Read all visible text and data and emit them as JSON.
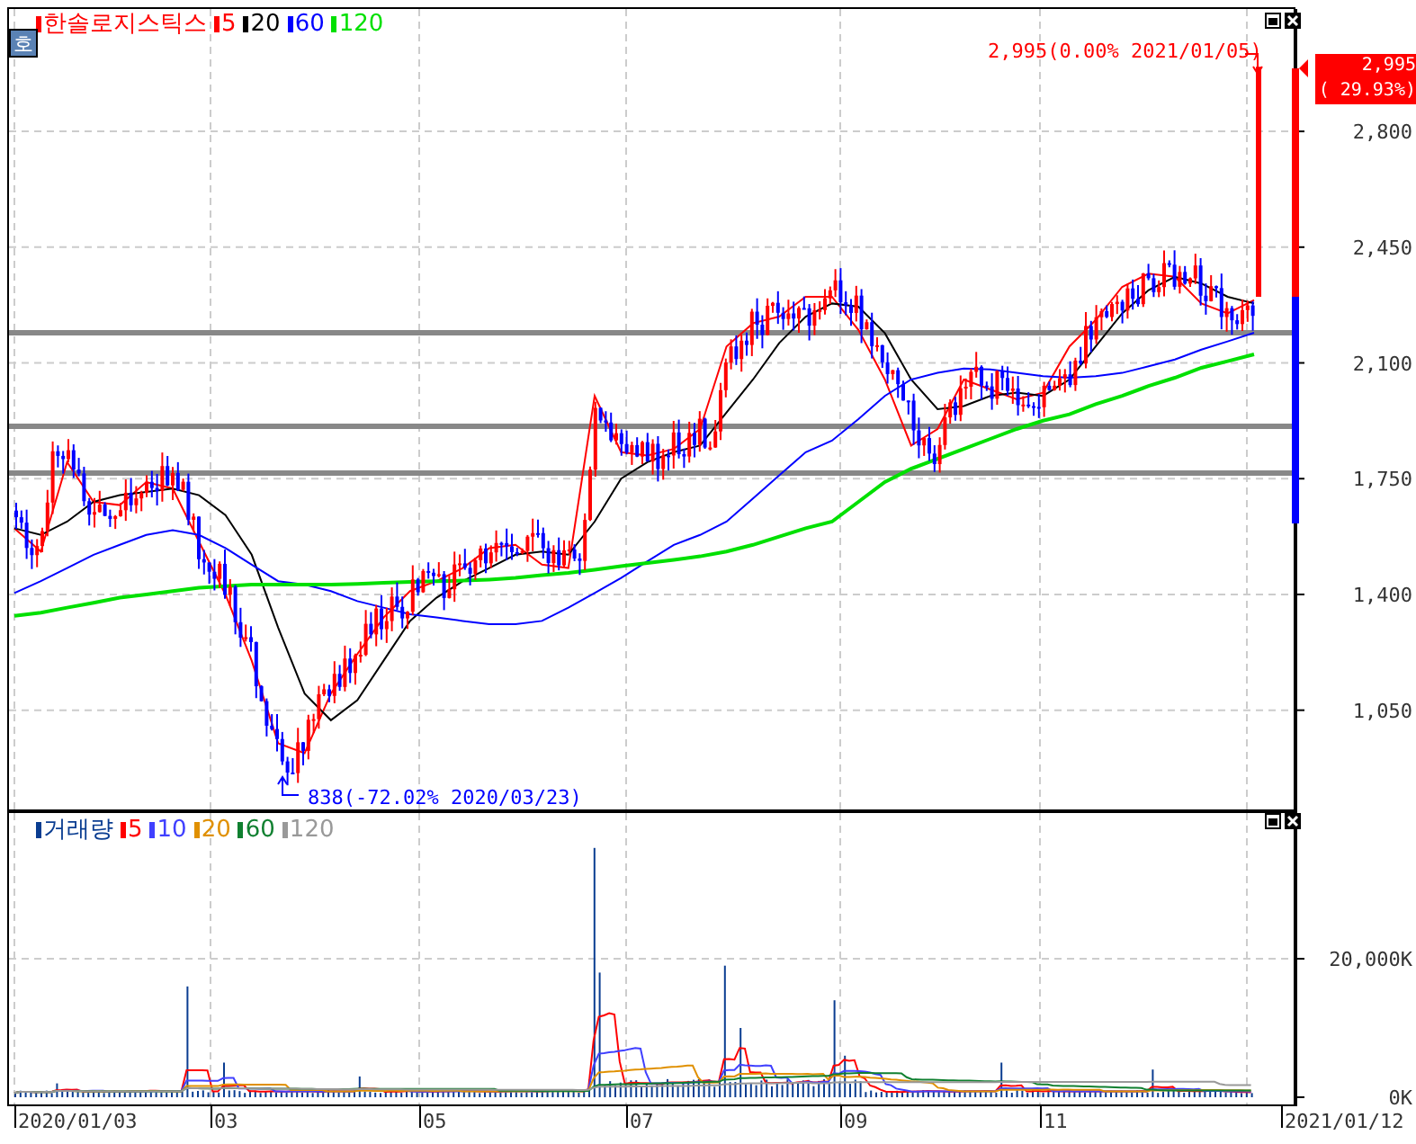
{
  "price_panel": {
    "badge": "호",
    "title": "한솔로지스틱스",
    "high_note": "2,995(0.00% 2021/01/05)",
    "low_note": "838(-72.02% 2020/03/23)",
    "current_price": "2,995",
    "current_change": "( 29.93%)",
    "chart_data": {
      "type": "line",
      "series": [
        {
          "name": "5",
          "color": "#ff0000",
          "values": [
            1600,
            1530,
            1800,
            1680,
            1670,
            1740,
            1720,
            1560,
            1400,
            1200,
            950,
            920,
            1100,
            1220,
            1330,
            1410,
            1440,
            1480,
            1540,
            1550,
            1490,
            1480,
            2000,
            1830,
            1820,
            1840,
            1900,
            2150,
            2220,
            2240,
            2300,
            2300,
            2200,
            2050,
            1850,
            1900,
            2050,
            2020,
            1990,
            2010,
            2150,
            2230,
            2330,
            2370,
            2360,
            2280,
            2250,
            2290
          ]
        },
        {
          "name": "20",
          "color": "#000000",
          "values": [
            1600,
            1580,
            1620,
            1680,
            1700,
            1710,
            1720,
            1700,
            1640,
            1520,
            1300,
            1100,
            1020,
            1080,
            1200,
            1320,
            1390,
            1440,
            1480,
            1520,
            1530,
            1520,
            1620,
            1750,
            1800,
            1830,
            1850,
            1950,
            2050,
            2160,
            2240,
            2280,
            2270,
            2190,
            2050,
            1960,
            1970,
            2000,
            2010,
            2000,
            2050,
            2150,
            2250,
            2320,
            2360,
            2340,
            2300,
            2280
          ]
        },
        {
          "name": "60",
          "color": "#0000ff",
          "values": [
            1404,
            1440,
            1480,
            1520,
            1550,
            1580,
            1594,
            1580,
            1540,
            1490,
            1440,
            1430,
            1410,
            1380,
            1360,
            1340,
            1330,
            1320,
            1310,
            1310,
            1320,
            1360,
            1404,
            1450,
            1500,
            1550,
            1580,
            1620,
            1690,
            1760,
            1830,
            1865,
            1930,
            2000,
            2050,
            2070,
            2083,
            2080,
            2070,
            2060,
            2055,
            2060,
            2070,
            2090,
            2110,
            2140,
            2165,
            2191
          ]
        },
        {
          "name": "120",
          "color": "#00e000",
          "values": [
            1335,
            1345,
            1360,
            1375,
            1390,
            1400,
            1410,
            1420,
            1425,
            1430,
            1430,
            1430,
            1430,
            1432,
            1435,
            1438,
            1440,
            1442,
            1445,
            1450,
            1458,
            1465,
            1475,
            1485,
            1495,
            1505,
            1515,
            1530,
            1550,
            1575,
            1600,
            1620,
            1680,
            1740,
            1780,
            1810,
            1840,
            1870,
            1900,
            1925,
            1945,
            1975,
            2000,
            2030,
            2055,
            2085,
            2105,
            2126
          ]
        }
      ],
      "ylim": [
        750,
        3170
      ],
      "grid": true,
      "yticks": [
        {
          "value": 2800,
          "label": "2,800"
        },
        {
          "value": 2450,
          "label": "2,450"
        },
        {
          "value": 2100,
          "label": "2,100"
        },
        {
          "value": 1750,
          "label": "1,750"
        },
        {
          "value": 1400,
          "label": "1,400"
        },
        {
          "value": 1050,
          "label": "1,050"
        }
      ]
    }
  },
  "volume_panel": {
    "legend": [
      {
        "label": "거래량",
        "color": "#0a3d91"
      },
      {
        "label": "5",
        "color": "#ff0000"
      },
      {
        "label": "10",
        "color": "#4040ff"
      },
      {
        "label": "20",
        "color": "#e09000"
      },
      {
        "label": "60",
        "color": "#108030"
      },
      {
        "label": "120",
        "color": "#999999"
      }
    ],
    "y_ticks": [
      "20,000K",
      "0K"
    ]
  },
  "x_axis": [
    "2020/01/03",
    "03",
    "05",
    "07",
    "09",
    "11",
    "2021/01/12"
  ]
}
